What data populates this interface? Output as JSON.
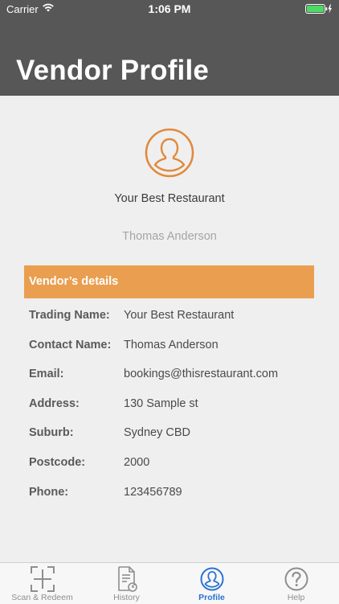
{
  "status_bar": {
    "carrier": "Carrier",
    "time": "1:06 PM",
    "wifi_icon": "wifi-icon",
    "battery_icon": "battery-charging-icon"
  },
  "header": {
    "title": "Vendor Profile",
    "background": "#575757"
  },
  "profile": {
    "avatar_icon": "user-circle-icon",
    "vendor_name": "Your Best Restaurant",
    "contact_person": "Thomas Anderson",
    "accent_color": "#e99f4f"
  },
  "details": {
    "section_title": "Vendor’s details",
    "rows": [
      {
        "label": "Trading Name:",
        "value": "Your Best Restaurant"
      },
      {
        "label": "Contact Name:",
        "value": "Thomas Anderson"
      },
      {
        "label": "Email:",
        "value": "bookings@thisrestaurant.com"
      },
      {
        "label": "Address:",
        "value": "130 Sample st"
      },
      {
        "label": "Suburb:",
        "value": "Sydney CBD"
      },
      {
        "label": "Postcode:",
        "value": "2000"
      },
      {
        "label": "Phone:",
        "value": "123456789"
      }
    ]
  },
  "tabbar": {
    "active_color": "#2a72d4",
    "tabs": [
      {
        "label": "Scan & Redeem",
        "icon": "scan-icon"
      },
      {
        "label": "History",
        "icon": "document-clock-icon"
      },
      {
        "label": "Profile",
        "icon": "user-circle-icon"
      },
      {
        "label": "Help",
        "icon": "help-icon"
      }
    ],
    "active_tab": "Profile"
  }
}
